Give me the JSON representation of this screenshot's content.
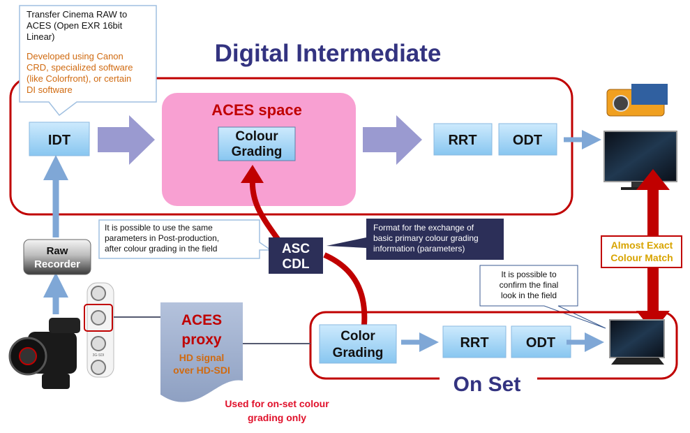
{
  "title": "Digital Intermediate",
  "idt_callout": {
    "lines": [
      "Transfer Cinema RAW to",
      "ACES (Open EXR 16bit",
      "Linear)"
    ],
    "note_lines": [
      "Developed using Canon",
      "CRD, specialized software",
      "(like Colorfront), or certain",
      "DI software"
    ]
  },
  "idt": "IDT",
  "aces_space": {
    "label": "ACES space",
    "grading": [
      "Colour",
      "Grading"
    ]
  },
  "rrt": "RRT",
  "odt": "ODT",
  "raw_recorder": [
    "Raw",
    "Recorder"
  ],
  "post_callout": [
    "It is possible to use the same",
    "parameters in Post-production,",
    "after colour grading in the field"
  ],
  "asc_cdl": [
    "ASC",
    "CDL"
  ],
  "format_callout": [
    "Format for the exchange of",
    "basic primary colour grading",
    "information (parameters)"
  ],
  "match": [
    "Almost Exact",
    "Colour Match"
  ],
  "confirm_callout": [
    "It is possible to",
    "confirm the final",
    "look in the field"
  ],
  "aces_proxy": {
    "title": [
      "ACES",
      "proxy"
    ],
    "sub": [
      "HD signal",
      "over HD-SDI"
    ]
  },
  "sdi_label": "3G-SDI",
  "used_for": [
    "Used for on-set colour",
    "grading only"
  ],
  "on_set": {
    "label": "On Set",
    "grading": [
      "Color",
      "Grading"
    ],
    "rrt": "RRT",
    "odt": "ODT"
  },
  "colors": {
    "title": "#333380",
    "frame": "#c00000",
    "box": "#a9d8f7",
    "arrow": "#9a9ad0",
    "pink": "#f8a0d2",
    "navy": "#2c2f58",
    "orange": "#d06a10",
    "gold": "#d8a400"
  }
}
